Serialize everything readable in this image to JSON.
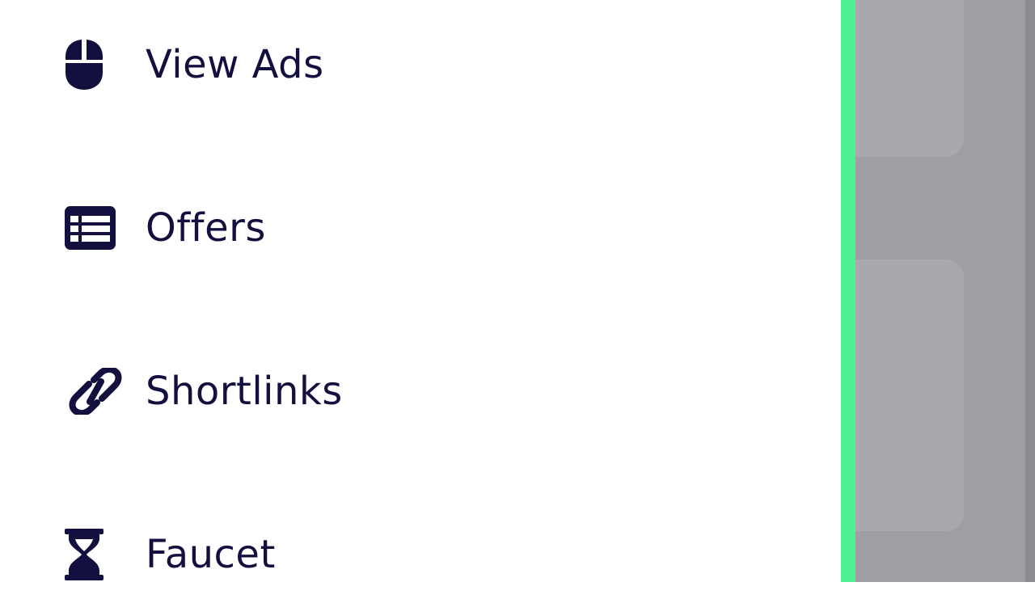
{
  "nav": {
    "items": [
      {
        "label": "View Ads",
        "icon": "mouse-icon"
      },
      {
        "label": "Offers",
        "icon": "table-list-icon"
      },
      {
        "label": "Shortlinks",
        "icon": "link-icon"
      },
      {
        "label": "Faucet",
        "icon": "hourglass-icon"
      }
    ]
  },
  "colors": {
    "text": "#13103f",
    "accent": "#4ef08f",
    "overlay": "#9d9fa3",
    "overlay_card": "#a7a9ad",
    "overlay_strip": "#8a8c90"
  }
}
